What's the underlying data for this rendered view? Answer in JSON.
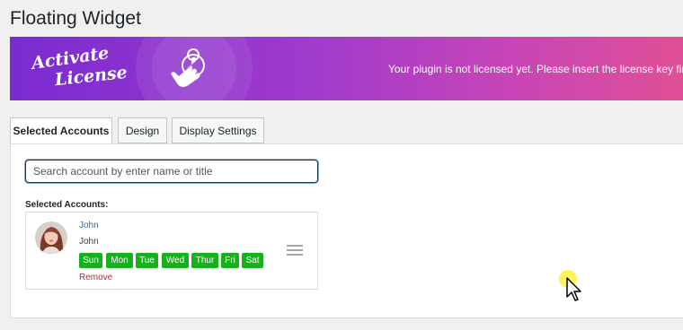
{
  "page": {
    "title": "Floating Widget"
  },
  "banner": {
    "logo_line1": "Activate",
    "logo_line2": "License",
    "message": "Your plugin is not licensed yet. Please insert the license key first"
  },
  "tabs": [
    {
      "label": "Selected Accounts",
      "active": true
    },
    {
      "label": "Design",
      "active": false
    },
    {
      "label": "Display Settings",
      "active": false
    }
  ],
  "search": {
    "placeholder": "Search account by enter name or title",
    "value": ""
  },
  "selected_accounts": {
    "label": "Selected Accounts:",
    "items": [
      {
        "name": "John",
        "username": "John",
        "days": [
          "Sun",
          "Mon",
          "Tue",
          "Wed",
          "Thur",
          "Fri",
          "Sat"
        ],
        "remove_label": "Remove"
      }
    ]
  },
  "colors": {
    "banner_start": "#7a2bd0",
    "banner_end": "#e05096",
    "day_badge": "#15b21b",
    "link": "#2271b1",
    "remove": "#b32d2e"
  },
  "icons": [
    "hand-tap-icon",
    "drag-handle-icon",
    "mouse-cursor-icon"
  ]
}
